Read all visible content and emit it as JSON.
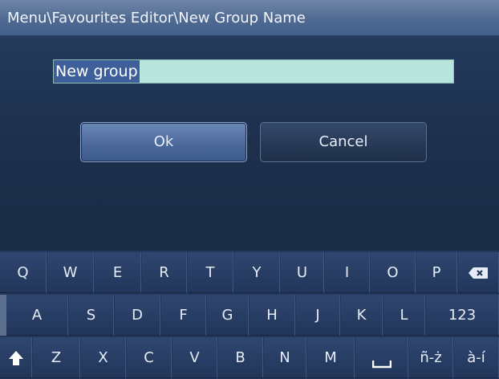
{
  "header": {
    "title": "Menu\\Favourites Editor\\New Group Name"
  },
  "form": {
    "name_value": "New group"
  },
  "buttons": {
    "ok_label": "Ok",
    "cancel_label": "Cancel"
  },
  "keyboard": {
    "row0": [
      "Q",
      "W",
      "E",
      "R",
      "T",
      "Y",
      "U",
      "I",
      "O",
      "P"
    ],
    "row1": [
      "A",
      "S",
      "D",
      "F",
      "G",
      "H",
      "J",
      "K",
      "L"
    ],
    "row2": [
      "Z",
      "X",
      "C",
      "V",
      "B",
      "N",
      "M"
    ],
    "numbers_label": "123",
    "accent1_label": "ñ-ż",
    "accent2_label": "à-í",
    "backspace_icon": "backspace-icon",
    "shift_icon": "shift-icon",
    "space_icon": "space-icon"
  }
}
